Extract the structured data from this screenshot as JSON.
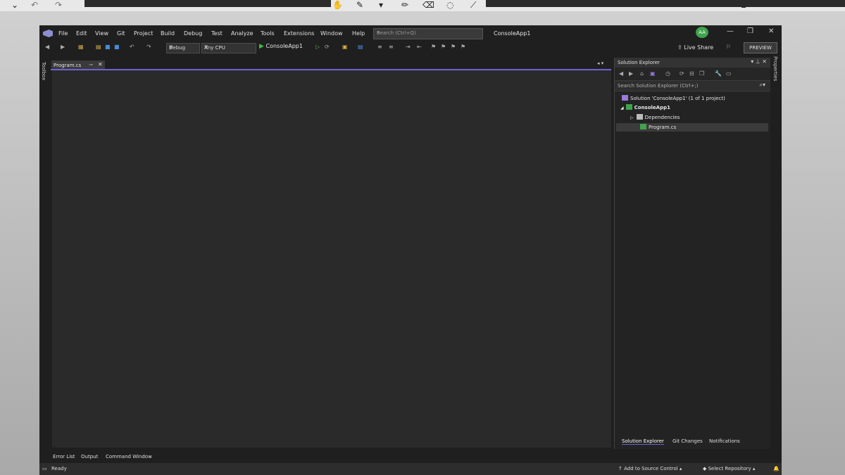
{
  "menu": [
    "File",
    "Edit",
    "View",
    "Git",
    "Project",
    "Build",
    "Debug",
    "Test",
    "Analyze",
    "Tools",
    "Extensions",
    "Window",
    "Help"
  ],
  "search": {
    "placeholder": "Search (Ctrl+Q)"
  },
  "window_title": "ConsoleApp1",
  "user_initials": "AA",
  "toolbar": {
    "config": "Debug",
    "platform": "Any CPU",
    "run_target": "ConsoleApp1",
    "live_share": "Live Share",
    "preview": "PREVIEW"
  },
  "side_strips": {
    "left": "Toolbox",
    "right": "Properties"
  },
  "editor": {
    "tab_label": "Program.cs"
  },
  "solution_explorer": {
    "title": "Solution Explorer",
    "search_placeholder": "Search Solution Explorer (Ctrl+;)",
    "tree": [
      {
        "label": "Solution 'ConsoleApp1' (1 of 1 project)",
        "icon": "solution-icon"
      },
      {
        "label": "ConsoleApp1",
        "icon": "csharp-project-icon"
      },
      {
        "label": "Dependencies",
        "icon": "dependencies-icon"
      },
      {
        "label": "Program.cs",
        "icon": "csharp-file-icon"
      }
    ],
    "bottom_tabs": [
      "Solution Explorer",
      "Git Changes",
      "Notifications"
    ]
  },
  "bottom_tabs": [
    "Error List",
    "Output",
    "Command Window"
  ],
  "status": {
    "left": "Ready",
    "source_control": "Add to Source Control",
    "repository": "Select Repository"
  },
  "colors": {
    "accent": "#6b62d6",
    "run_green": "#3fbf46",
    "avatar": "#3fa34d"
  }
}
